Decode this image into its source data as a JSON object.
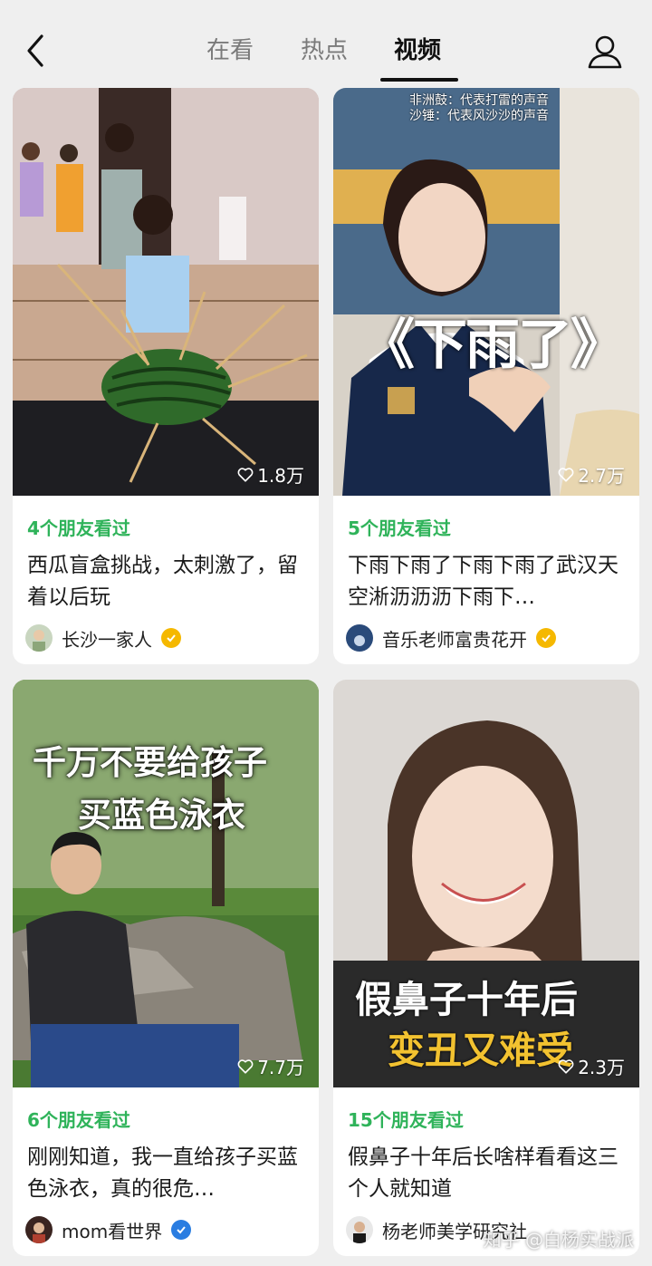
{
  "nav": {
    "back_icon": "chevron-left-icon",
    "tabs": [
      {
        "label": "在看",
        "active": false
      },
      {
        "label": "热点",
        "active": false
      },
      {
        "label": "视频",
        "active": true
      }
    ],
    "profile_icon": "user-icon"
  },
  "cards": [
    {
      "likes": "1.8万",
      "friends": "4个朋友看过",
      "title": "西瓜盲盒挑战，太刺激了，留着以后玩",
      "author": "长沙一家人",
      "badge_color": "#f5b800"
    },
    {
      "likes": "2.7万",
      "friends": "5个朋友看过",
      "title": "下雨下雨了下雨下雨了武汉天空淅沥沥沥下雨下…",
      "author": "音乐老师富贵花开",
      "badge_color": "#f5b800",
      "caption_line1": "非洲鼓：代表打雷的声音",
      "caption_line2": "沙锤：代表风沙沙的声音",
      "overlay": "《下雨了》"
    },
    {
      "likes": "7.7万",
      "friends": "6个朋友看过",
      "title": "刚刚知道，我一直给孩子买蓝色泳衣，真的很危…",
      "author": "mom看世界",
      "badge_color": "#2a7de1",
      "overlay_line1": "千万不要给孩子",
      "overlay_line2": "买蓝色泳衣"
    },
    {
      "likes": "2.3万",
      "friends": "15个朋友看过",
      "title": "假鼻子十年后长啥样看看这三个人就知道",
      "author": "杨老师美学研究社",
      "overlay_line1": "假鼻子十年后",
      "overlay_line2": "变丑又难受"
    }
  ],
  "watermark": "知乎 @白杨实战派",
  "colors": {
    "accent_green": "#2fb35a",
    "background": "#efefef"
  }
}
